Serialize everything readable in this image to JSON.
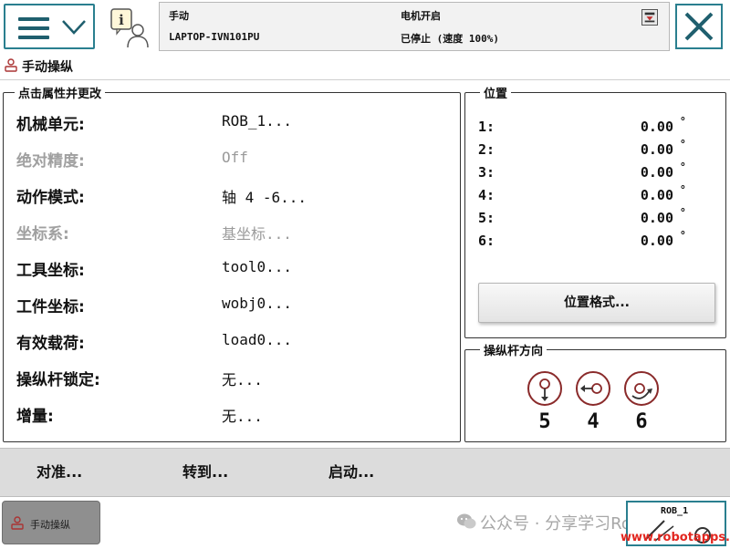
{
  "header": {
    "mode": "手动",
    "system_name": "LAPTOP-IVN101PU",
    "motor_state": "电机开启",
    "program_state": "已停止 (速度 100%)"
  },
  "subtitle": "手动操纵",
  "properties": {
    "legend": "点击属性并更改",
    "rows": [
      {
        "label": "机械单元:",
        "value": "ROB_1...",
        "enabled": true
      },
      {
        "label": "绝对精度:",
        "value": "Off",
        "enabled": false
      },
      {
        "label": "动作模式:",
        "value": "轴 4 -6...",
        "enabled": true
      },
      {
        "label": "坐标系:",
        "value": "基坐标...",
        "enabled": false
      },
      {
        "label": "工具坐标:",
        "value": "tool0...",
        "enabled": true
      },
      {
        "label": "工件坐标:",
        "value": "wobj0...",
        "enabled": true
      },
      {
        "label": "有效载荷:",
        "value": "load0...",
        "enabled": true
      },
      {
        "label": "操纵杆锁定:",
        "value": "无...",
        "enabled": true
      },
      {
        "label": "增量:",
        "value": "无...",
        "enabled": true
      }
    ]
  },
  "position": {
    "legend": "位置",
    "unit": "°",
    "axes": [
      {
        "axis": "1:",
        "value": "0.00"
      },
      {
        "axis": "2:",
        "value": "0.00"
      },
      {
        "axis": "3:",
        "value": "0.00"
      },
      {
        "axis": "4:",
        "value": "0.00"
      },
      {
        "axis": "5:",
        "value": "0.00"
      },
      {
        "axis": "6:",
        "value": "0.00"
      }
    ],
    "format_button": "位置格式..."
  },
  "joystick": {
    "legend": "操纵杆方向",
    "numbers": [
      "5",
      "4",
      "6"
    ]
  },
  "actions": {
    "align": "对准...",
    "goto": "转到...",
    "start": "启动..."
  },
  "taskbar": {
    "task_label": "手动操纵",
    "quickset_label": "ROB_1",
    "watermark": "公众号 · 分享学习Robot",
    "site": "www.robotapps.cn"
  },
  "colors": {
    "accent": "#2a7f8f",
    "site_red": "#e2261f"
  }
}
